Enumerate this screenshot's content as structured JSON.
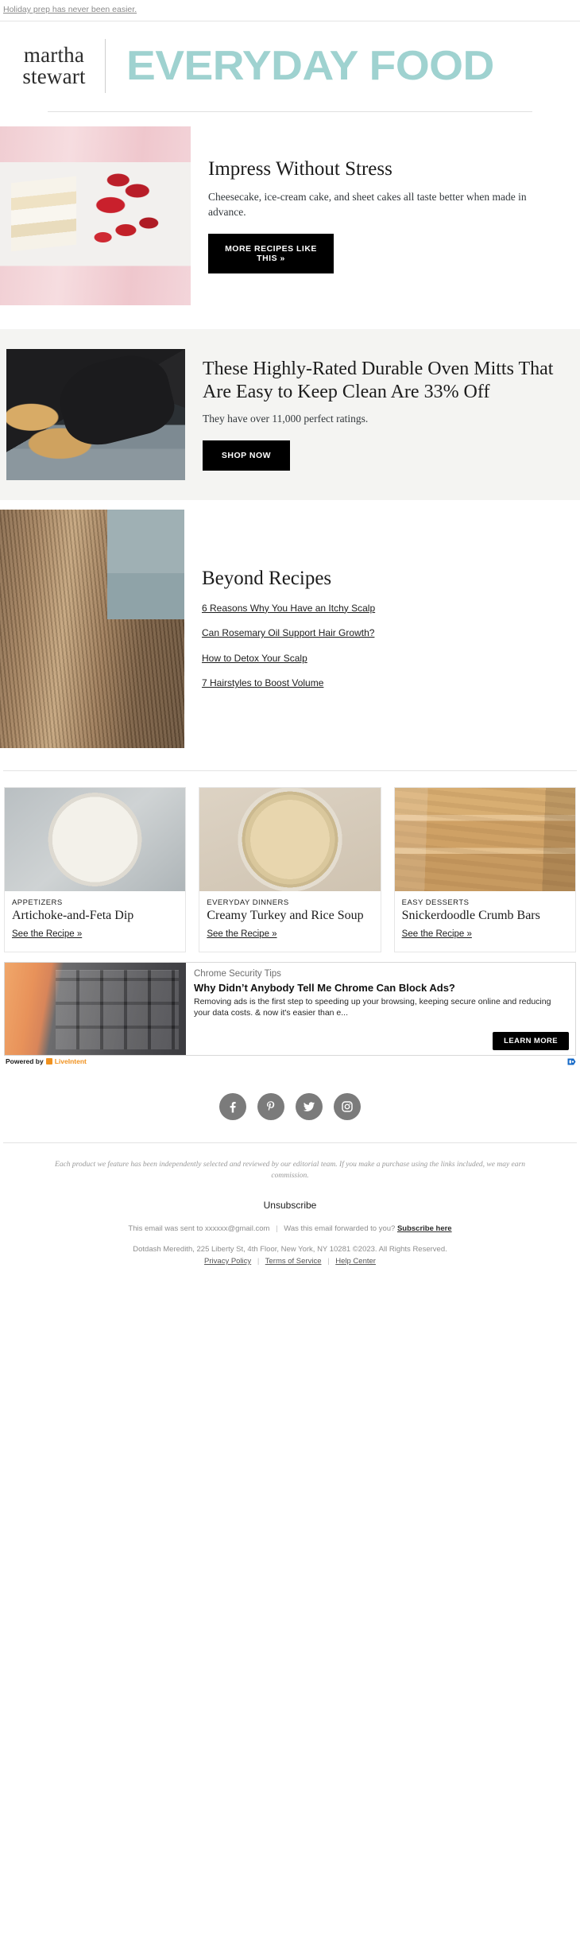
{
  "colors": {
    "brand_teal": "#9fd2d0",
    "cta_black": "#000000",
    "band_grey": "#f4f4f2",
    "social_grey": "#7b7b7b",
    "liveintent_orange": "#f0911e"
  },
  "preheader": {
    "text": "Holiday prep has never been easier."
  },
  "masthead": {
    "logo_line1": "martha",
    "logo_line2": "stewart",
    "title": "EVERYDAY FOOD"
  },
  "blocks": [
    {
      "image_name": "sheet-cake-photo",
      "headline": "Impress Without Stress",
      "dek": "Cheesecake, ice-cream cake, and sheet cakes all taste better when made in advance.",
      "cta": "MORE RECIPES LIKE THIS »"
    },
    {
      "image_name": "oven-mitt-photo",
      "headline": "These Highly-Rated Durable Oven Mitts That Are Easy to Keep Clean Are 33% Off",
      "dek": "They have over 11,000 perfect ratings.",
      "cta": "SHOP NOW"
    }
  ],
  "beyond": {
    "image_name": "scalp-hair-photo",
    "headline": "Beyond Recipes",
    "links": [
      "6 Reasons Why You Have an Itchy Scalp",
      "Can Rosemary Oil Support Hair Growth?",
      "How to Detox Your Scalp",
      "7 Hairstyles to Boost Volume"
    ]
  },
  "cards": [
    {
      "image_name": "artichoke-feta-dip-photo",
      "category": "APPETIZERS",
      "title": "Artichoke-and-Feta Dip",
      "link": "See the Recipe »"
    },
    {
      "image_name": "turkey-rice-soup-photo",
      "category": "EVERYDAY DINNERS",
      "title": "Creamy Turkey and Rice Soup",
      "link": "See the Recipe »"
    },
    {
      "image_name": "snickerdoodle-crumb-bars-photo",
      "category": "EASY DESSERTS",
      "title": "Snickerdoodle Crumb Bars",
      "link": "See the Recipe »"
    }
  ],
  "ad": {
    "image_name": "keyboard-finger-photo",
    "kicker": "Chrome Security Tips",
    "title": "Why Didn’t Anybody Tell Me Chrome Can Block Ads?",
    "description": "Removing ads is the first step to speeding up your browsing, keeping secure online and reducing your data costs. & now it's easier than e...",
    "cta": "LEARN MORE",
    "powered_by_label": "Powered by",
    "powered_by_brand": "LiveIntent"
  },
  "social": [
    {
      "name": "facebook-icon",
      "glyph": "f"
    },
    {
      "name": "pinterest-icon",
      "glyph": "P"
    },
    {
      "name": "twitter-icon",
      "glyph": "t"
    },
    {
      "name": "instagram-icon",
      "glyph": "o"
    }
  ],
  "footer": {
    "disclaimer": "Each product we feature has been independently selected and reviewed by our editorial team. If you make a purchase using the links included, we may earn commission.",
    "unsubscribe": "Unsubscribe",
    "sent_to_prefix": "This email was sent to",
    "sent_to_email": "xxxxxx@gmail.com",
    "forwarded_question": "Was this email forwarded to you?",
    "subscribe_here": "Subscribe here",
    "address": "Dotdash Meredith, 225 Liberty St, 4th Floor, New York, NY 10281 ©2023. All Rights Reserved.",
    "privacy_policy": "Privacy Policy",
    "terms_of_service": "Terms of Service",
    "help_center": "Help Center",
    "separator": "|"
  }
}
